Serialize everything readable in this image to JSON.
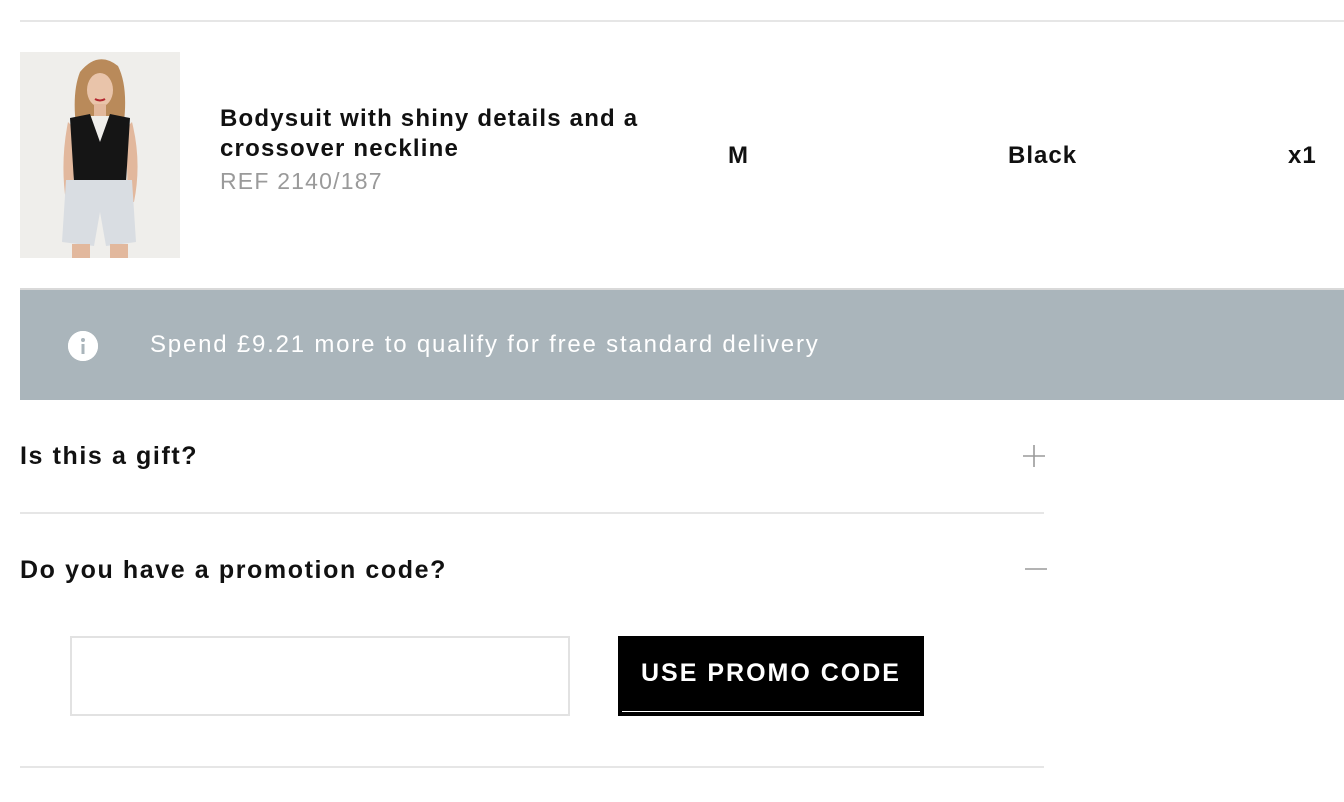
{
  "cart_item": {
    "title": "Bodysuit with shiny details and a crossover neckline",
    "ref": "REF 2140/187",
    "size": "M",
    "color": "Black",
    "quantity": "x1",
    "image_icon": "product-photo"
  },
  "delivery_banner": {
    "icon": "info-icon",
    "text": "Spend £9.21 more to qualify for free standard delivery",
    "background": "#aab5bb"
  },
  "gift": {
    "title": "Is this a gift?",
    "icon": "plus-icon",
    "expanded": false
  },
  "promo": {
    "title": "Do you have a promotion code?",
    "icon": "minus-icon",
    "expanded": true,
    "input_value": "",
    "button_label": "USE PROMO CODE"
  }
}
